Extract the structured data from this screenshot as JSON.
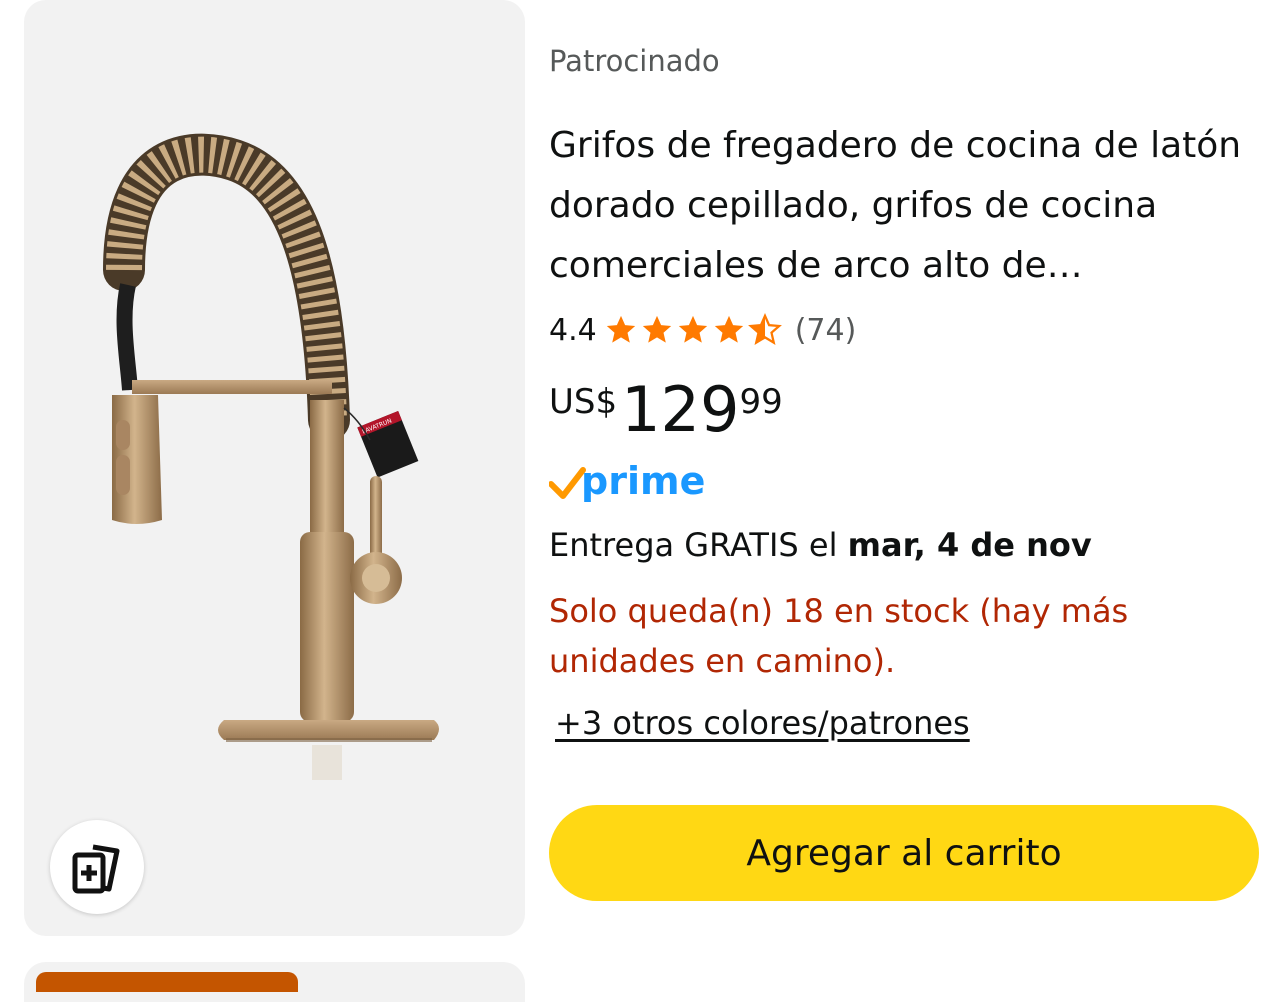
{
  "product": {
    "image_alt": "Grifo de cocina dorado con resorte",
    "tag_text": "LAVATRUN",
    "sponsored_label": "Patrocinado",
    "title": "Grifos de fregadero de cocina de latón dorado cepillado, grifos de cocina comerciales de arco alto de…",
    "rating": "4.4",
    "rating_stars": 4.4,
    "review_count": "(74)",
    "price": {
      "symbol": "US$",
      "whole": "129",
      "fraction": "99"
    },
    "prime_label": "prime",
    "delivery": {
      "prefix": "Entrega GRATIS el ",
      "date": "mar, 4 de nov"
    },
    "stock_message": "Solo queda(n) 18 en stock (hay más unidades en camino).",
    "other_colors_link": "+3 otros colores/patrones",
    "add_to_cart_label": "Agregar al carrito"
  },
  "icons": {
    "compare": "compare-cards-icon",
    "star": "star-icon",
    "prime_check": "prime-check-icon"
  },
  "colors": {
    "star": "#ff7a00",
    "prime_blue": "#1a98ff",
    "prime_orange": "#ff9900",
    "stock_red": "#b12704",
    "cart_button": "#ffd814",
    "secondary_text": "#565959"
  }
}
